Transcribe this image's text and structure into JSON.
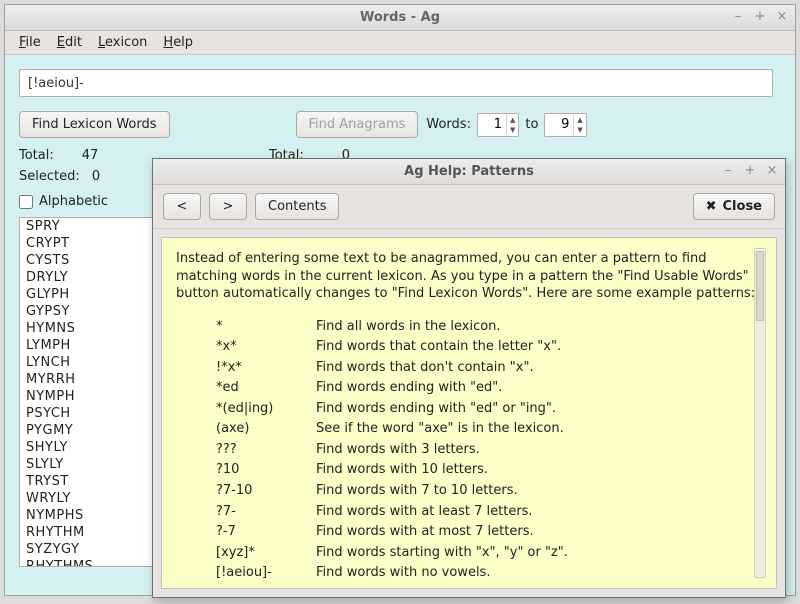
{
  "main_window": {
    "title": "Words - Ag",
    "menus": {
      "file": "File",
      "edit": "Edit",
      "lexicon": "Lexicon",
      "help": "Help"
    },
    "search_value": "[!aeiou]-",
    "find_lexicon_btn": "Find Lexicon Words",
    "find_anagrams_btn": "Find Anagrams",
    "words_label": "Words:",
    "words_from": "1",
    "to_label": "to",
    "words_to": "9",
    "left_total_label": "Total:",
    "left_total_value": "47",
    "selected_label": "Selected:",
    "selected_value": "0",
    "right_total_label": "Total:",
    "right_total_value": "0",
    "alphabetic_label": "Alphabetic",
    "word_list": [
      "SPRY",
      "CRYPT",
      "CYSTS",
      "DRYLY",
      "GLYPH",
      "GYPSY",
      "HYMNS",
      "LYMPH",
      "LYNCH",
      "MYRRH",
      "NYMPH",
      "PSYCH",
      "PYGMY",
      "SHYLY",
      "SLYLY",
      "TRYST",
      "WRYLY",
      "NYMPHS",
      "RHYTHM",
      "SYZYGY",
      "RHYTHMS"
    ]
  },
  "help_window": {
    "title": "Ag Help: Patterns",
    "nav_prev": "<",
    "nav_next": ">",
    "contents_btn": "Contents",
    "close_btn": "Close",
    "intro": "Instead of entering some text to be anagrammed, you can enter a pattern to find matching words in the current lexicon. As you type in a pattern the \"Find Usable Words\" button automatically changes to \"Find Lexicon Words\". Here are some example patterns:",
    "patterns": [
      {
        "p": "*",
        "d": "Find all words in the lexicon."
      },
      {
        "p": "*x*",
        "d": "Find words that contain the letter \"x\"."
      },
      {
        "p": "!*x*",
        "d": "Find words that don't contain \"x\"."
      },
      {
        "p": "*ed",
        "d": "Find words ending with \"ed\"."
      },
      {
        "p": "*(ed|ing)",
        "d": "Find words ending with \"ed\" or \"ing\"."
      },
      {
        "p": "(axe)",
        "d": "See if the word \"axe\" is in the lexicon."
      },
      {
        "p": "???",
        "d": "Find words with 3 letters."
      },
      {
        "p": "?10",
        "d": "Find words with 10 letters."
      },
      {
        "p": "?7-10",
        "d": "Find words with 7 to 10 letters."
      },
      {
        "p": "?7-",
        "d": "Find words with at least 7 letters."
      },
      {
        "p": "?-7",
        "d": "Find words with at most 7 letters."
      },
      {
        "p": "[xyz]*",
        "d": "Find words starting with \"x\", \"y\" or \"z\"."
      },
      {
        "p": "[!aeiou]-",
        "d": "Find words with no vowels."
      }
    ]
  }
}
